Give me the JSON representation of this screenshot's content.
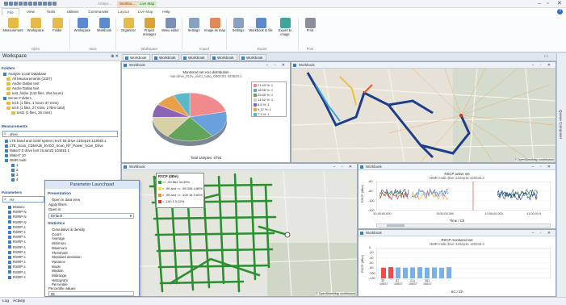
{
  "window": {
    "title_context_1": "Analys...",
    "title_context_2": "Workbo...",
    "title_context_3": "Live Map",
    "minimize": "–",
    "maximize": "▫",
    "close": "✕",
    "help": "?"
  },
  "ribbon_tabs": [
    "File",
    "View",
    "Tools",
    "Utilities",
    "Commander",
    "Layout",
    "Live Map",
    "Help"
  ],
  "ribbon": {
    "open": {
      "measurement": "Measurement",
      "workspace": "Workspace",
      "folder": "Folder",
      "group": "Open"
    },
    "save": {
      "workspace": "Workspace",
      "workbook": "Workbook",
      "group": "Save"
    },
    "workspace_group": {
      "organizer": "Organizer",
      "project_manager": "Project manager",
      "menu_editor": "Menu editor",
      "group": "Workspace"
    },
    "import": {
      "settings": "Settings",
      "image_as_map": "Image as map",
      "group": "Import"
    },
    "export": {
      "settings": "Settings",
      "workbook_to_file": "Workbook to file",
      "export_to_image": "Export to image",
      "group": "Export"
    },
    "print": {
      "print": "Print",
      "group": "Print"
    }
  },
  "workspace": {
    "title": "Workspace",
    "pin": "⊕ ✕",
    "folders_label": "Folders",
    "folders": [
      "Analyze Local Database",
      "All Measurements (1007)",
      "Andre Dallas test",
      "Andre Dallas test",
      "test_folder (143 files, 254 hours)",
      "Server Folders",
      "tech (1 files, 1 hours 37 mins)",
      "tech (1 files, 27 mins, 2 files total)",
      "test1 (1 files, 26 mins)"
    ],
    "measurements_label": "Measurements",
    "search_value": "drive",
    "measurements": [
      "LTE band and GSM system; tech 55 drive 14Sep19 123045.1",
      "LTE_Scan_CDMA2k_EVDO_Scan_RF_Power_Scan_Drive",
      "Mater7.0 drive test 15Jan22 104815.1",
      "Mater7 10",
      "NMR multi",
      "1",
      "2",
      "3",
      "4"
    ],
    "parameters_label": "Parameters",
    "param_search": "rsr",
    "parameters": [
      "Distanc",
      "RSRP N",
      "RSRP N",
      "RSRP N",
      "RSRP s",
      "RSRP s",
      "RSRP s",
      "RSRP s",
      "RSRP s",
      "RSRP s",
      "RSRP s",
      "RSRP s",
      "RSRP s",
      "RSRP s",
      "RSRP s"
    ]
  },
  "launchpad": {
    "title": "Parameter Launchpad",
    "presentation_label": "Presentation",
    "presentation_items": [
      "Open in data view",
      "Apply filters"
    ],
    "open_in_label": "Open in:",
    "open_in_value": "Default",
    "statistics_label": "Statistics",
    "statistics_items": [
      "Cumulative & density",
      "Count",
      "Average",
      "Minimum",
      "Maximum",
      "Threshold",
      "Standard deviation",
      "Variance",
      "Mode",
      "Median",
      "Midrange",
      "Histogram",
      "Percentile"
    ],
    "percentile_values_label": "Percentile values",
    "percentile_value": "85"
  },
  "doc_tabs": [
    "Workbook",
    "Workbook",
    "Workbook",
    "Workbook",
    "Workbook"
  ],
  "panels": {
    "pie": {
      "title": "Workbook"
    },
    "map_top": {
      "title": "Workbook",
      "attribution": "© OpenStreetMap contributors"
    },
    "map_bottom": {
      "title": "Workbook",
      "attribution": "© OpenStreetMap contributors"
    },
    "line": {
      "title": "Workbook"
    },
    "bar": {
      "title": "Workbook"
    }
  },
  "map_legend": {
    "title": "RSCP (dBm)",
    "rows": [
      {
        "range": ">= -90",
        "count": "862",
        "pct": "34.39%",
        "color": "#1e9e3a"
      },
      {
        "range": "< -90 and >= -95",
        "count": "336",
        "pct": "4.89%",
        "color": "#f2e33a"
      },
      {
        "range": "< -95 and >= -100",
        "count": "16",
        "pct": "0.63%",
        "color": "#f0902c"
      },
      {
        "range": "< -100",
        "count": "1",
        "pct": "0.02%",
        "color": "#d8302a"
      }
    ]
  },
  "chart_data": [
    {
      "type": "pie",
      "title": "Monitored set ecio distribution",
      "subtitle": "nuk.drive_012v_vidcr_tutto_08Oct01 023520.1",
      "footer": "Total samples: 6750",
      "labels": [
        "21.43 %: 1",
        "18.08 %: 1",
        "20.65 %: 1",
        "14.62 %: 1",
        "8.8 %: 1",
        "9.12 %: 1",
        "7.3 %: 1"
      ],
      "values": [
        21.43,
        18.08,
        20.65,
        14.62,
        8.8,
        9.12,
        7.3
      ],
      "colors": [
        "#f08a8c",
        "#6aa0db",
        "#63a35a",
        "#d8d1a6",
        "#8b63b6",
        "#e8a04a",
        "#5bb8c9"
      ]
    },
    {
      "type": "line",
      "title": "RSCP active set",
      "subtitle": "NMR multi drive 14Sep11 120344.2",
      "xlabel": "Time / Ch",
      "ylabel": "RSCP (dBm)",
      "yticks": [
        "-60",
        "-80",
        "-100",
        "-120"
      ],
      "xticks": [
        "10:40:00.000",
        "10:50:00.000",
        "10:59:00.000",
        "11:00:00.0"
      ],
      "ylim": [
        -120,
        -60
      ]
    },
    {
      "type": "bar",
      "title": "RSCP monitored set",
      "subtitle": "NMR multi drive 14Sep11 120344.2",
      "xlabel": "SC / Ch",
      "ylabel": "RSCP (dBm)",
      "yticks": [
        "0",
        "-20",
        "-40",
        "-60",
        "-80",
        "-100",
        "-120"
      ],
      "ylim": [
        -120,
        0
      ],
      "categories": [
        "30 10837",
        "87 10837",
        "211 10837",
        "381 10837"
      ],
      "values": [
        -78,
        -76,
        -77,
        -78,
        -77,
        -76,
        -78,
        -77,
        -78,
        -76
      ],
      "bar_colors": [
        "#ef4b4b",
        "#ef4b4b",
        "#7ab0e6",
        "#7ab0e6",
        "#7ab0e6",
        "#7ab0e6",
        "#7ab0e6",
        "#7ab0e6",
        "#7ab0e6",
        "#7ab0e6"
      ]
    }
  ],
  "right_strip": {
    "label": "Queue Composer"
  },
  "status": {
    "log": "Log",
    "activity": "Activity"
  }
}
